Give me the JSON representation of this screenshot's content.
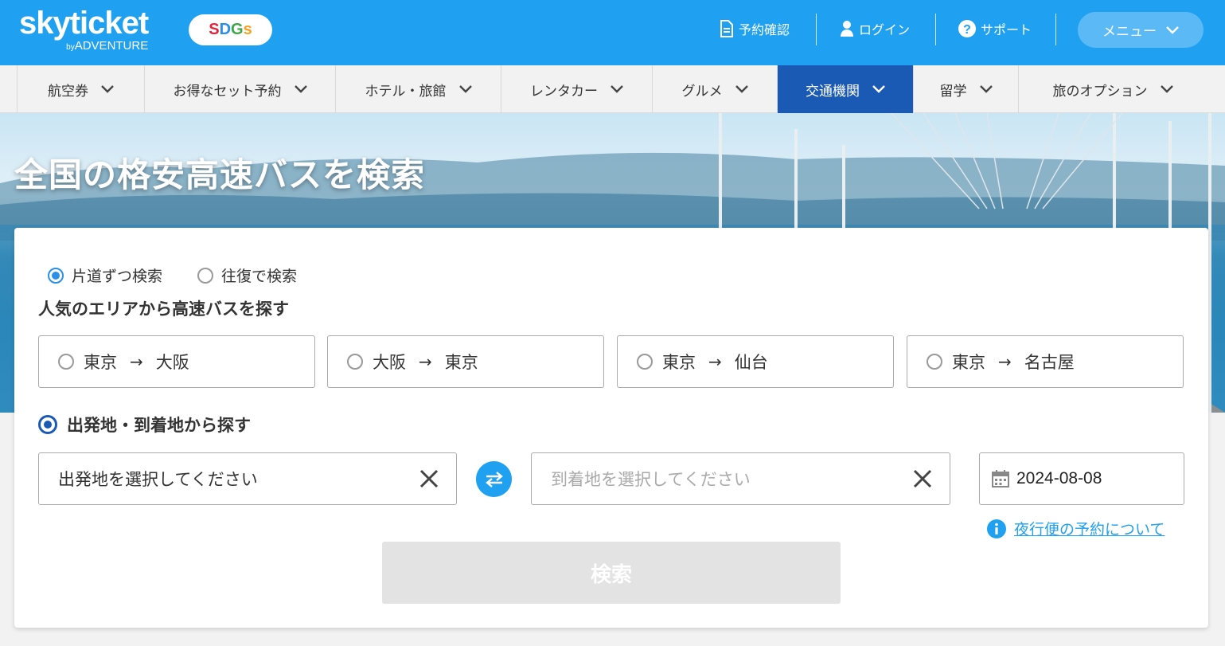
{
  "header": {
    "logo_main": "skyticket",
    "logo_sub_by": "by",
    "logo_sub_name": "ADVENTURE",
    "sdgs_letters": [
      "S",
      "D",
      "G",
      "s"
    ],
    "sdgs_colors": [
      "#e5243b",
      "#2a8fe8",
      "#3fa648",
      "#f4a11d"
    ],
    "links": [
      {
        "label": "予約確認",
        "icon": "document-icon"
      },
      {
        "label": "ログイン",
        "icon": "user-icon"
      },
      {
        "label": "サポート",
        "icon": "help-icon"
      }
    ],
    "menu_label": "メニュー"
  },
  "nav": {
    "items": [
      {
        "label": "航空券",
        "active": false
      },
      {
        "label": "お得なセット予約",
        "active": false
      },
      {
        "label": "ホテル・旅館",
        "active": false
      },
      {
        "label": "レンタカー",
        "active": false
      },
      {
        "label": "グルメ",
        "active": false
      },
      {
        "label": "交通機関",
        "active": true
      },
      {
        "label": "留学",
        "active": false
      },
      {
        "label": "旅のオプション",
        "active": false
      }
    ]
  },
  "hero": {
    "title": "全国の格安高速バスを検索"
  },
  "search": {
    "trip_types": [
      {
        "label": "片道ずつ検索",
        "selected": true
      },
      {
        "label": "往復で検索",
        "selected": false
      }
    ],
    "popular_title": "人気のエリアから高速バスを探す",
    "popular_routes": [
      {
        "from": "東京",
        "to": "大阪"
      },
      {
        "from": "大阪",
        "to": "東京"
      },
      {
        "from": "東京",
        "to": "仙台"
      },
      {
        "from": "東京",
        "to": "名古屋"
      }
    ],
    "arrow": "→",
    "custom_title": "出発地・到着地から探す",
    "departure": {
      "value": "出発地を選択してください"
    },
    "arrival": {
      "placeholder": "到着地を選択してください"
    },
    "date": "2024-08-08",
    "night_link": "夜行便の予約について",
    "search_button": "検索"
  },
  "colors": {
    "header_bg": "#1fa0f0",
    "active_nav": "#1a5ab4",
    "accent": "#2a8fe8",
    "button_disabled": "#e3e3e3"
  }
}
